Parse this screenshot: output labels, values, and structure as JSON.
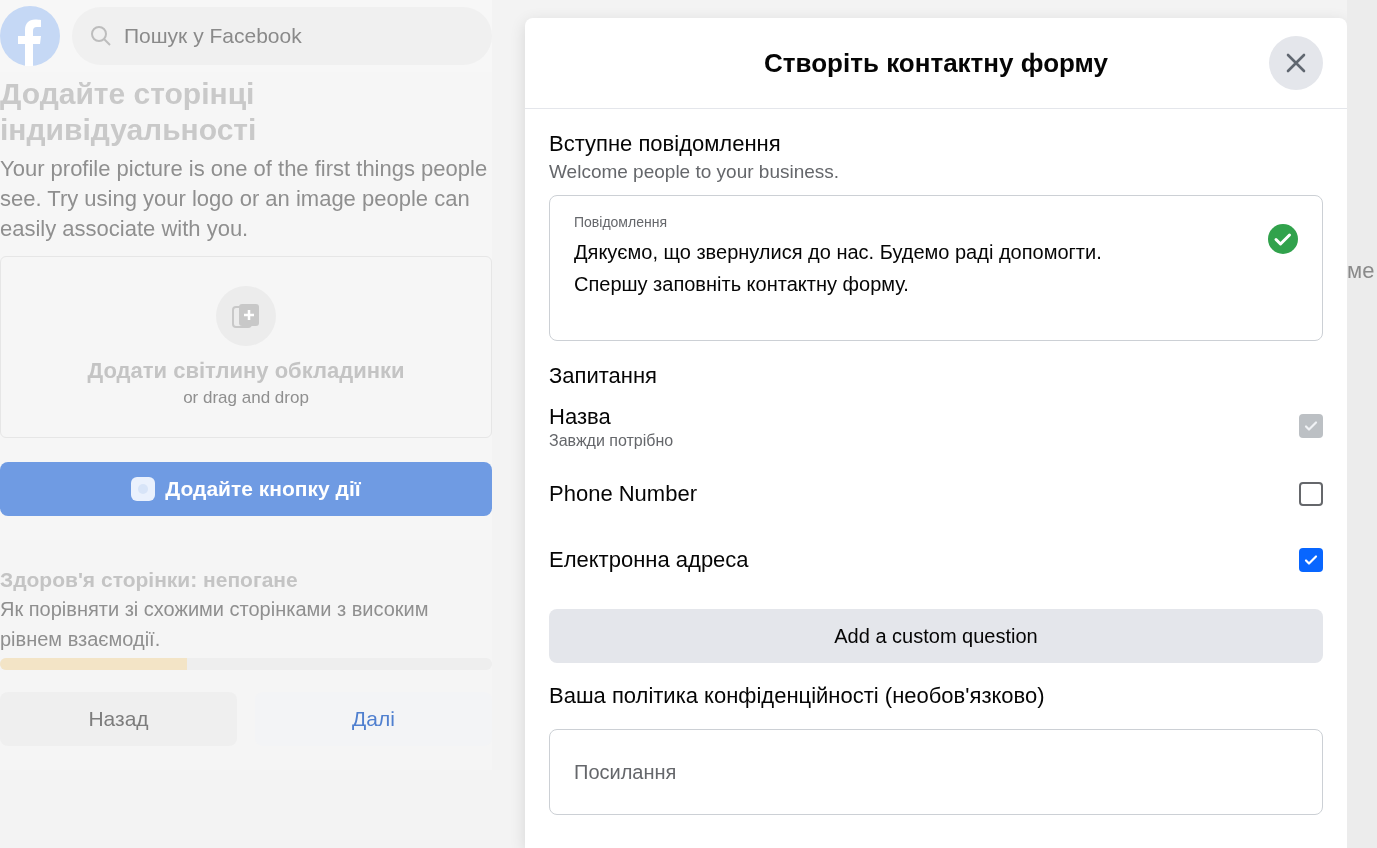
{
  "header": {
    "search": {
      "placeholder": "Пошук у Facebook"
    }
  },
  "background_page": {
    "title": "Додайте сторінці індивідуальності",
    "description": "Your profile picture is one of the first things people see. Try using your logo or an image people can easily associate with you.",
    "cover_upload": {
      "label": "Додати світлину обкладинки",
      "hint": "or drag and drop"
    },
    "action_button": {
      "label": "Додайте кнопку дії"
    },
    "health": {
      "title": "Здоров'я сторінки: непогане",
      "description": "Як порівняти зі схожими сторінками з високим рівнем взаємодії.",
      "level": 0.38
    },
    "buttons": [
      {
        "label": "Назад",
        "kind": "secondary"
      },
      {
        "label": "Далі",
        "kind": "primary"
      }
    ]
  },
  "right_fragment": {
    "text": "ме"
  },
  "dialog": {
    "title": "Створіть контактну форму",
    "intro": {
      "heading": "Вступне повідомлення",
      "subtitle": "Welcome people to your business.",
      "field": {
        "label": "Повідомлення",
        "value": "Дякуємо, що звернулися до нас. Будемо раді допомогти. Спершу заповніть контактну форму.",
        "valid": true
      }
    },
    "questions": {
      "heading": "Запитання",
      "items": [
        {
          "label": "Назва",
          "note": "Завжди потрібно",
          "checked": true,
          "disabled": true
        },
        {
          "label": "Phone Number",
          "checked": false,
          "disabled": false
        },
        {
          "label": "Електронна адреса",
          "checked": true,
          "disabled": false
        }
      ]
    },
    "custom_button": {
      "label": "Add a custom question"
    },
    "privacy": {
      "heading": "Ваша політика конфіденційності (необов'язково)",
      "placeholder": "Посилання"
    }
  }
}
